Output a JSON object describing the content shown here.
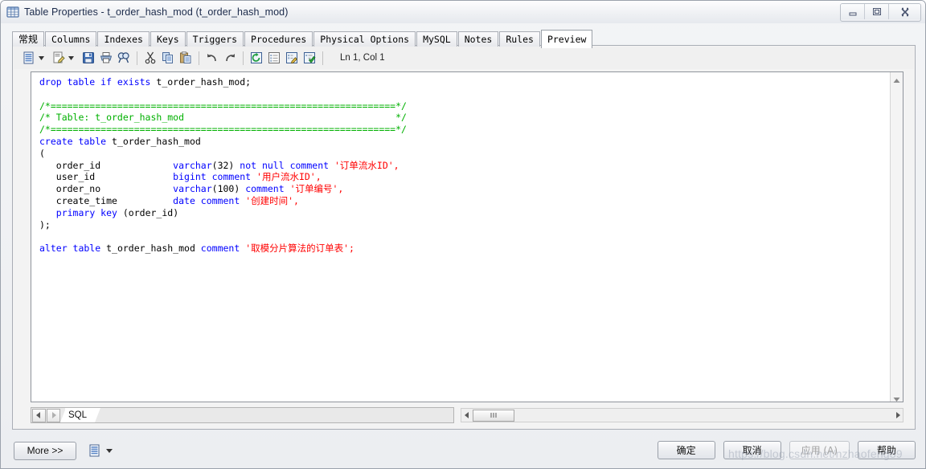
{
  "window": {
    "title": "Table Properties - t_order_hash_mod (t_order_hash_mod)",
    "icon": "table-icon",
    "controls": {
      "minimize": "minimize-icon",
      "maximize": "maximize-icon",
      "close": "close-icon"
    }
  },
  "tabs": [
    {
      "label": "常规",
      "cjk": true,
      "active": false
    },
    {
      "label": "Columns",
      "cjk": false,
      "active": false
    },
    {
      "label": "Indexes",
      "cjk": false,
      "active": false
    },
    {
      "label": "Keys",
      "cjk": false,
      "active": false
    },
    {
      "label": "Triggers",
      "cjk": false,
      "active": false
    },
    {
      "label": "Procedures",
      "cjk": false,
      "active": false
    },
    {
      "label": "Physical Options",
      "cjk": false,
      "active": false
    },
    {
      "label": "MySQL",
      "cjk": false,
      "active": false
    },
    {
      "label": "Notes",
      "cjk": false,
      "active": false
    },
    {
      "label": "Rules",
      "cjk": false,
      "active": false
    },
    {
      "label": "Preview",
      "cjk": false,
      "active": true
    }
  ],
  "toolbar": {
    "items": [
      {
        "name": "new-document-icon",
        "type": "dropdown"
      },
      {
        "name": "edit-document-icon",
        "type": "dropdown"
      },
      {
        "name": "save-icon",
        "type": "button"
      },
      {
        "name": "print-icon",
        "type": "button"
      },
      {
        "name": "find-icon",
        "type": "button"
      },
      {
        "name": "cut-icon",
        "type": "button"
      },
      {
        "name": "copy-icon",
        "type": "button"
      },
      {
        "name": "paste-icon",
        "type": "button"
      },
      {
        "name": "undo-icon",
        "type": "button"
      },
      {
        "name": "redo-icon",
        "type": "button"
      },
      {
        "name": "refresh-icon",
        "type": "button"
      },
      {
        "name": "list-view-icon",
        "type": "button"
      },
      {
        "name": "edit-script-icon",
        "type": "button"
      },
      {
        "name": "validate-script-icon",
        "type": "button"
      }
    ],
    "cursor_position": "Ln 1, Col 1"
  },
  "editor": {
    "language": "sql",
    "lines": [
      [
        {
          "t": "drop table if exists",
          "c": "kw"
        },
        {
          "t": " t_order_hash_mod;",
          "c": "plain"
        }
      ],
      [],
      [
        {
          "t": "/*==============================================================*/",
          "c": "cmt"
        }
      ],
      [
        {
          "t": "/* Table: t_order_hash_mod                                      */",
          "c": "cmt"
        }
      ],
      [
        {
          "t": "/*==============================================================*/",
          "c": "cmt"
        }
      ],
      [
        {
          "t": "create table",
          "c": "kw"
        },
        {
          "t": " t_order_hash_mod",
          "c": "plain"
        }
      ],
      [
        {
          "t": "(",
          "c": "plain"
        }
      ],
      [
        {
          "t": "   order_id             ",
          "c": "plain"
        },
        {
          "t": "varchar",
          "c": "kw"
        },
        {
          "t": "(32) ",
          "c": "plain"
        },
        {
          "t": "not null comment",
          "c": "kw"
        },
        {
          "t": " '订单流水ID',",
          "c": "str"
        }
      ],
      [
        {
          "t": "   user_id              ",
          "c": "plain"
        },
        {
          "t": "bigint comment",
          "c": "kw"
        },
        {
          "t": " '用户流水ID',",
          "c": "str"
        }
      ],
      [
        {
          "t": "   order_no             ",
          "c": "plain"
        },
        {
          "t": "varchar",
          "c": "kw"
        },
        {
          "t": "(100) ",
          "c": "plain"
        },
        {
          "t": "comment",
          "c": "kw"
        },
        {
          "t": " '订单编号',",
          "c": "str"
        }
      ],
      [
        {
          "t": "   create_time          ",
          "c": "plain"
        },
        {
          "t": "date comment",
          "c": "kw"
        },
        {
          "t": " '创建时间',",
          "c": "str"
        }
      ],
      [
        {
          "t": "   ",
          "c": "plain"
        },
        {
          "t": "primary key",
          "c": "kw"
        },
        {
          "t": " (order_id)",
          "c": "plain"
        }
      ],
      [
        {
          "t": ");",
          "c": "plain"
        }
      ],
      [],
      [
        {
          "t": "alter table",
          "c": "kw"
        },
        {
          "t": " t_order_hash_mod ",
          "c": "plain"
        },
        {
          "t": "comment",
          "c": "kw"
        },
        {
          "t": " '取模分片算法的订单表';",
          "c": "str"
        }
      ]
    ],
    "vertical_scrollbar": {
      "up": "scroll-up-arrow-icon",
      "down": "scroll-down-arrow-icon"
    }
  },
  "pagebar": {
    "prev_label": "◀",
    "next_label": "▶",
    "sheet_tab": "SQL",
    "hscroll": {
      "left_arrow": "◀",
      "right_arrow": "▶",
      "thumb": "⦀"
    }
  },
  "bottom": {
    "more_label": "More >>",
    "script_icon": "script-icon",
    "dropdown_icon": "chevron-down-icon",
    "buttons": [
      {
        "label": "确定",
        "name": "ok-button",
        "disabled": false
      },
      {
        "label": "取消",
        "name": "cancel-button",
        "disabled": false
      },
      {
        "label": "应用 (A)",
        "name": "apply-button",
        "disabled": true
      },
      {
        "label": "帮助",
        "name": "help-button",
        "disabled": false
      }
    ]
  },
  "watermark": "https://blog.csdn.net/nzhaofeng89",
  "colors": {
    "keyword": "#0000ff",
    "comment": "#00b000",
    "string": "#ff0000",
    "text": "#000000",
    "window_bg": "#f0f0f0",
    "editor_bg": "#ffffff"
  }
}
